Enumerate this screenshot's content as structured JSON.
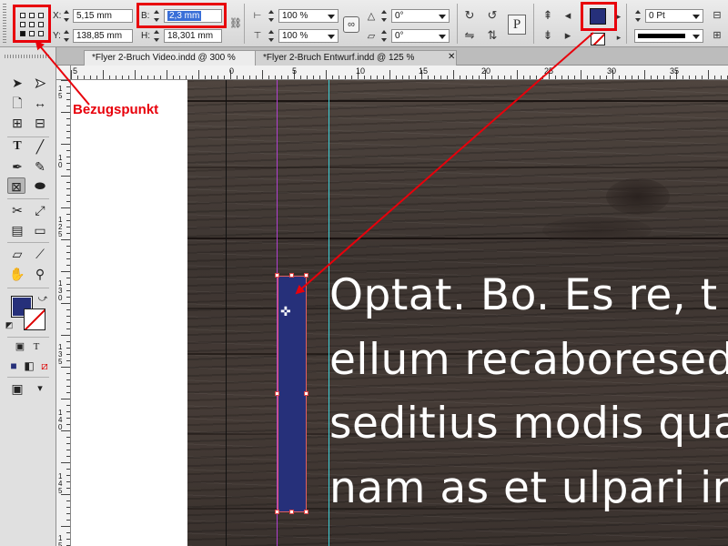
{
  "control_bar": {
    "x_label": "X:",
    "x_value": "5,15 mm",
    "y_label": "Y:",
    "y_value": "138,85 mm",
    "w_label": "B:",
    "w_value": "2,3 mm",
    "h_label": "H:",
    "h_value": "18,301 mm",
    "scale_x": "100 %",
    "scale_y": "100 %",
    "rotation": "0°",
    "shear": "0°",
    "stroke_weight": "0 Pt",
    "text_frame_icon": "P"
  },
  "tabs": [
    {
      "label": "*Flyer 2-Bruch Video.indd @ 300 %",
      "active": true
    },
    {
      "label": "*Flyer 2-Bruch Entwurf.indd @ 125 %",
      "active": false
    }
  ],
  "ruler": {
    "h_numbers": [
      "5",
      "0",
      "5",
      "10",
      "15",
      "20",
      "25",
      "30",
      "35"
    ],
    "v_numbers": [
      "1 5",
      "1 0",
      "1 2 5",
      "1 3 0",
      "1 3 5",
      "1 4 0",
      "1 4 5",
      "1 5"
    ]
  },
  "document": {
    "text_lines": [
      "Optat. Bo. Es re, t",
      "ellum recaboresed",
      "seditius modis qua",
      "nam as et ulpari in"
    ]
  },
  "annotation": {
    "label": "Bezugspunkt"
  },
  "colors": {
    "fill": "#26307a",
    "highlight": "#e8000b"
  }
}
